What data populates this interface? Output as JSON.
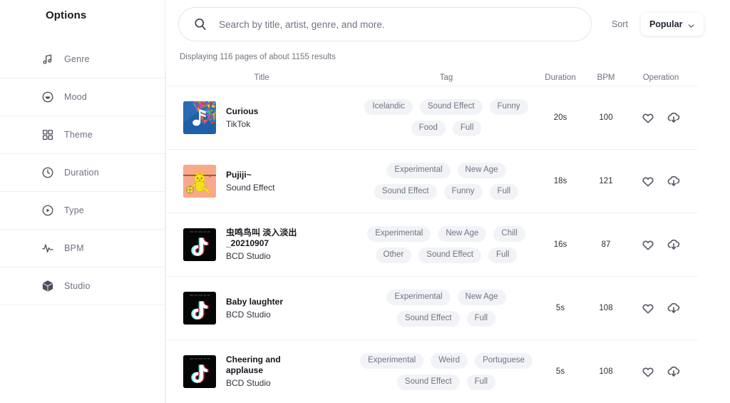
{
  "sidebar": {
    "title": "Options",
    "items": [
      {
        "label": "Genre",
        "icon": "music-note-icon"
      },
      {
        "label": "Mood",
        "icon": "smiley-circle-icon"
      },
      {
        "label": "Theme",
        "icon": "grid-icon"
      },
      {
        "label": "Duration",
        "icon": "clock-icon"
      },
      {
        "label": "Type",
        "icon": "play-circle-icon"
      },
      {
        "label": "BPM",
        "icon": "waveform-icon"
      },
      {
        "label": "Studio",
        "icon": "cube-icon"
      }
    ]
  },
  "search": {
    "placeholder": "Search by title, artist, genre, and more.",
    "value": "",
    "icon": "search-icon"
  },
  "sort": {
    "label": "Sort",
    "selected": "Popular",
    "icon": "chevron-down-icon"
  },
  "results_count": "Displaying 116 pages of about 1155 results",
  "table": {
    "columns": [
      "Title",
      "Tag",
      "Duration",
      "BPM",
      "Operation"
    ],
    "rows": [
      {
        "title": "Curious",
        "artist": "TikTok",
        "thumb": "confetti-music-note",
        "tags": [
          "Icelandic",
          "Sound Effect",
          "Funny",
          "Food",
          "Full"
        ],
        "duration": "20s",
        "bpm": "100",
        "operations": [
          "heart-icon",
          "cloud-download-icon"
        ]
      },
      {
        "title": "Pujiji~",
        "artist": "Sound Effect",
        "thumb": "yellow-cat",
        "tags": [
          "Experimental",
          "New Age",
          "Sound Effect",
          "Funny",
          "Full"
        ],
        "duration": "18s",
        "bpm": "121",
        "operations": [
          "heart-icon",
          "cloud-download-icon"
        ]
      },
      {
        "title": "虫鸣鸟叫 淡入淡出_20210907",
        "artist": "BCD Studio",
        "thumb": "tiktok",
        "tags": [
          "Experimental",
          "New Age",
          "Chill",
          "Other",
          "Sound Effect",
          "Full"
        ],
        "duration": "16s",
        "bpm": "87",
        "operations": [
          "heart-icon",
          "cloud-download-icon"
        ]
      },
      {
        "title": "Baby laughter",
        "artist": "BCD Studio",
        "thumb": "tiktok",
        "tags": [
          "Experimental",
          "New Age",
          "Sound Effect",
          "Full"
        ],
        "duration": "5s",
        "bpm": "108",
        "operations": [
          "heart-icon",
          "cloud-download-icon"
        ]
      },
      {
        "title": "Cheering and applause",
        "artist": "BCD Studio",
        "thumb": "tiktok",
        "tags": [
          "Experimental",
          "Weird",
          "Portuguese",
          "Sound Effect",
          "Full"
        ],
        "duration": "5s",
        "bpm": "108",
        "operations": [
          "heart-icon",
          "cloud-download-icon"
        ]
      }
    ]
  },
  "colors": {
    "tag_bg": "#f2f3f7",
    "tag_text": "#70757f",
    "divider": "#f0f0f3",
    "text_primary": "#14161c",
    "text_muted": "#6b7280"
  }
}
